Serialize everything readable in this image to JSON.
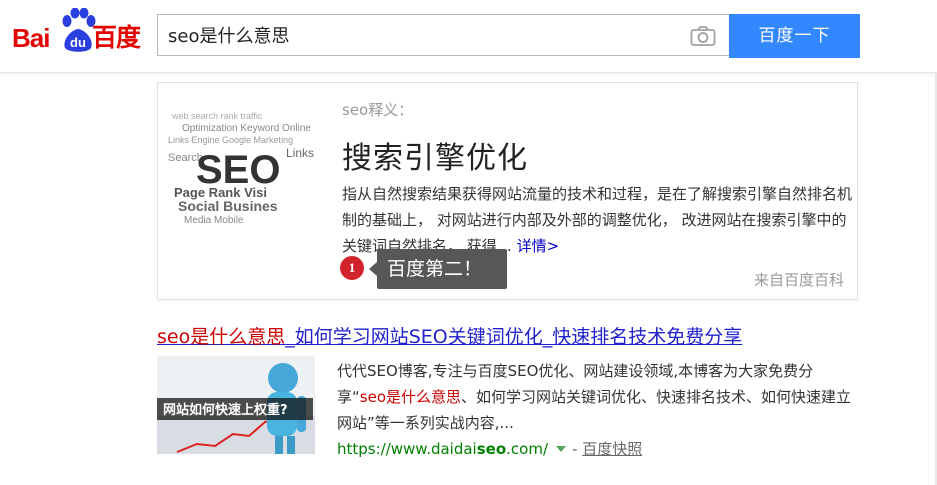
{
  "header": {
    "logo_left": "Bai",
    "logo_paw": "du",
    "logo_right": "百度",
    "search_value": "seo是什么意思",
    "search_button": "百度一下",
    "camera_icon": "camera-icon"
  },
  "card": {
    "image_text": "SEO",
    "label": "seo释义：",
    "title": "搜索引擎优化",
    "description": "指从自然搜索结果获得网站流量的技术和过程，是在了解搜索引擎自然排名机制的基础上， 对网站进行内部及外部的调整优化， 改进网站在搜索引擎中的关键词自然排名， 获得…",
    "detail_link": "详情>",
    "source": "来自百度百科"
  },
  "tooltip": {
    "badge": "1",
    "text": "百度第二！"
  },
  "result": {
    "title_hl": "seo是什么意思",
    "title_rest": "_如何学习网站SEO关键词优化_快速排名技术免费分享",
    "thumb_text": "网站如何快速上权重?",
    "desc_1": "代代SEO博客,专注与百度SEO优化、网站建设领域,本博客为大家免费分享“",
    "desc_hl": "seo是什么意思",
    "desc_2": "、如何学习网站关键词优化、快速排名技术、如何快速建立网站”等一系列实战内容,...",
    "url_1": "https://www.daidai",
    "url_bold": "seo",
    "url_2": ".com/",
    "sep": "-",
    "snapshot": "百度快照"
  },
  "colors": {
    "brand_red": "#e10602",
    "brand_blue": "#2b3fe0",
    "button_blue": "#3388ff",
    "link_blue": "#2222cc",
    "highlight_red": "#cc0000",
    "url_green": "#008000"
  }
}
